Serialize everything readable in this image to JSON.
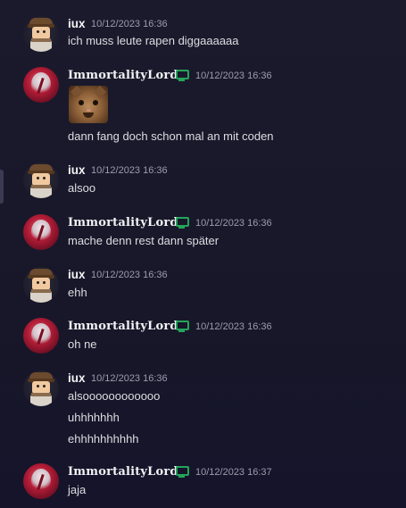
{
  "messages": [
    {
      "author": "iux",
      "timestamp": "10/12/2023 16:36",
      "lines": [
        "ich muss leute rapen diggaaaaaa"
      ]
    },
    {
      "author": "ImmortalityLord",
      "timestamp": "10/12/2023 16:36",
      "has_image": true,
      "lines": [
        "dann fang doch schon mal an mit coden"
      ]
    },
    {
      "author": "iux",
      "timestamp": "10/12/2023 16:36",
      "lines": [
        "alsoo"
      ]
    },
    {
      "author": "ImmortalityLord",
      "timestamp": "10/12/2023 16:36",
      "lines": [
        "mache denn rest dann später"
      ]
    },
    {
      "author": "iux",
      "timestamp": "10/12/2023 16:36",
      "lines": [
        "ehh"
      ]
    },
    {
      "author": "ImmortalityLord",
      "timestamp": "10/12/2023 16:36",
      "lines": [
        "oh ne"
      ]
    },
    {
      "author": "iux",
      "timestamp": "10/12/2023 16:36",
      "lines": [
        "alsoooooooooooo",
        "uhhhhhhh",
        "ehhhhhhhhhh"
      ]
    },
    {
      "author": "ImmortalityLord",
      "timestamp": "10/12/2023 16:37",
      "lines": [
        "jaja"
      ]
    }
  ],
  "icons": {
    "desktop_badge": "monitor-icon",
    "accent": "#23a55a"
  }
}
